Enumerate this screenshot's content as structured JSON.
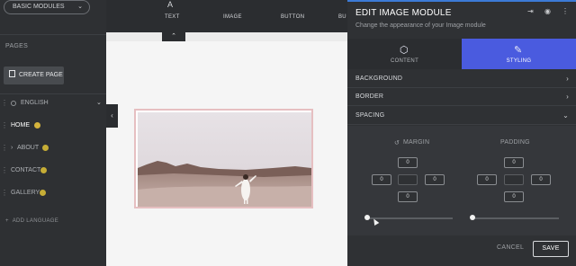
{
  "sidebar": {
    "module_select": "BASIC MODULES",
    "pages_label": "PAGES",
    "create_page": "CREATE PAGE",
    "language": "ENGLISH",
    "pages": [
      {
        "label": "HOME"
      },
      {
        "label": "ABOUT"
      },
      {
        "label": "CONTACT"
      },
      {
        "label": "GALLERY"
      }
    ],
    "add_language": "ADD LANGUAGE"
  },
  "toolbar": {
    "items": [
      "TEXT",
      "IMAGE",
      "BUTTON",
      "BU"
    ]
  },
  "panel": {
    "title": "EDIT IMAGE MODULE",
    "subtitle": "Change the appearance of your Image module",
    "tabs": [
      {
        "label": "CONTENT",
        "icon": "cube-icon",
        "active": false
      },
      {
        "label": "STYLING",
        "icon": "brush-icon",
        "active": true
      }
    ],
    "sections": [
      "BACKGROUND",
      "BORDER",
      "SPACING"
    ],
    "spacing": {
      "margin_label": "MARGIN",
      "padding_label": "PADDING",
      "margin": {
        "top": "0",
        "left": "0",
        "right": "0",
        "bottom": "0"
      },
      "padding": {
        "top": "0",
        "left": "0",
        "right": "0",
        "bottom": "0"
      }
    },
    "cancel": "CANCEL",
    "save": "SAVE"
  },
  "colors": {
    "accent": "#4a5bdf",
    "topbar": "#3c7ad6",
    "home_icon": "#d4b33c",
    "frame": "#e6bfc1"
  }
}
